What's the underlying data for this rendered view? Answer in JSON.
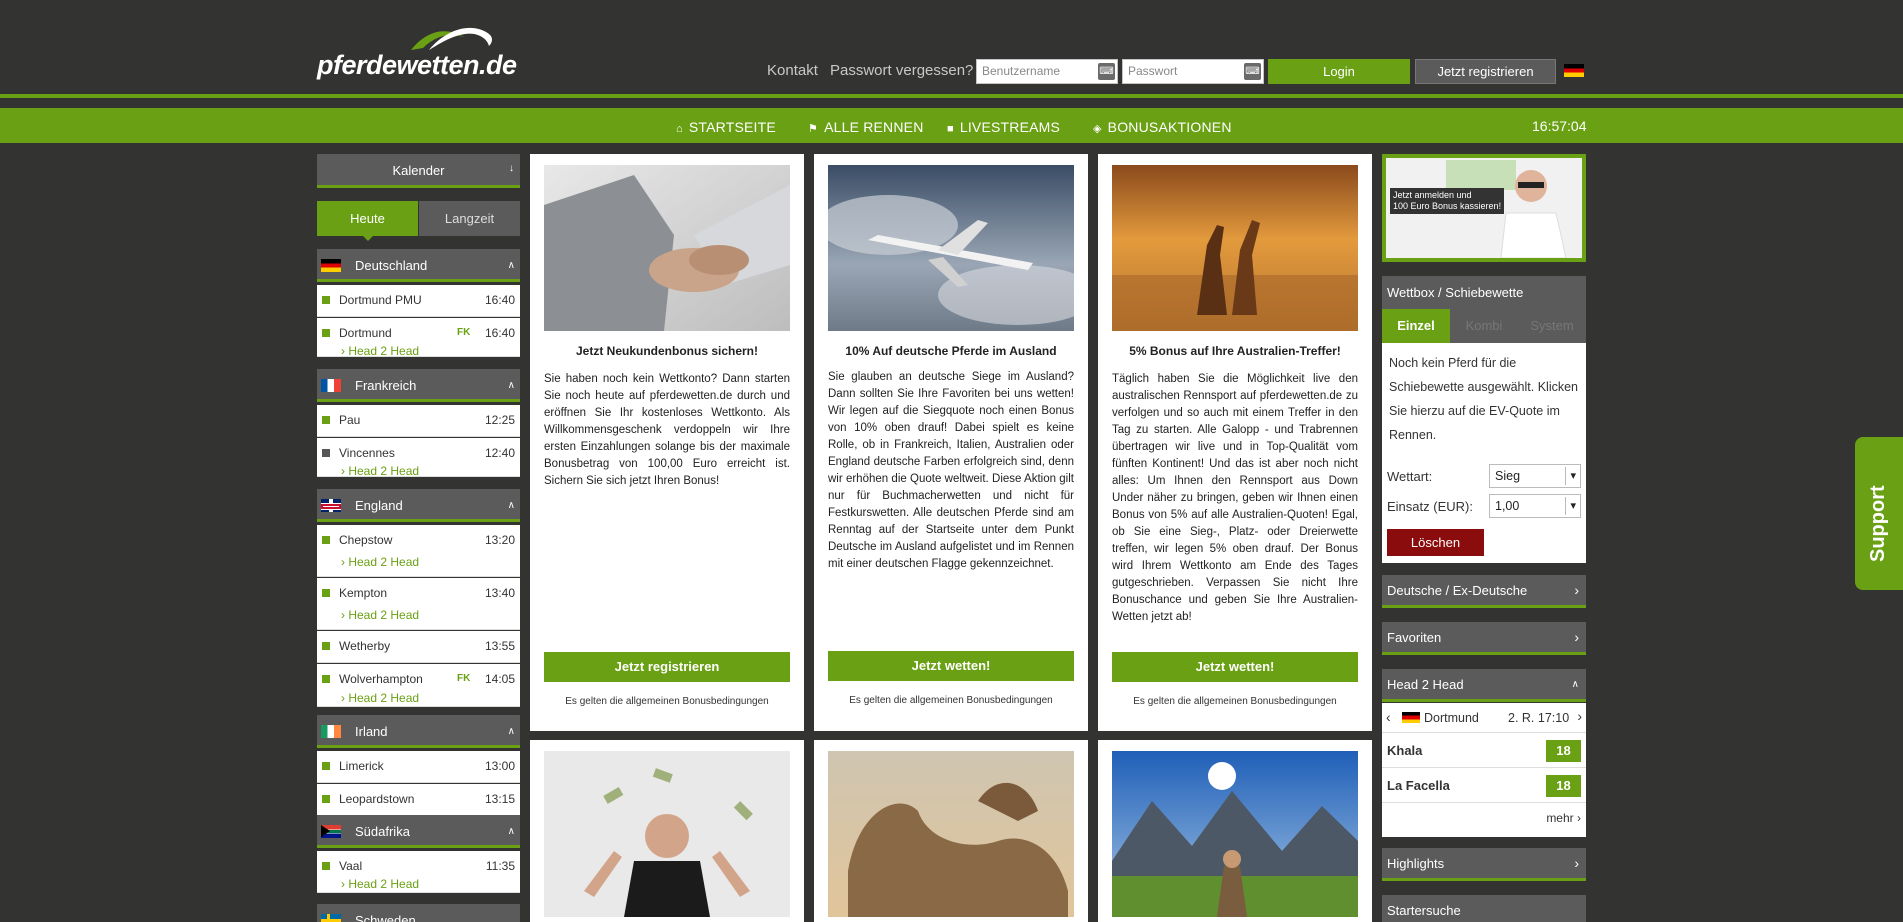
{
  "header": {
    "logo_text": "pferdewetten.de",
    "links": {
      "contact": "Kontakt",
      "forgot": "Passwort vergessen?"
    },
    "username_placeholder": "Benutzername",
    "password_placeholder": "Passwort",
    "login_label": "Login",
    "register_label": "Jetzt registrieren",
    "language_flag": "de-flag-icon"
  },
  "nav": {
    "items": [
      {
        "label": "STARTSEITE",
        "icon": "home-icon"
      },
      {
        "label": "ALLE RENNEN",
        "icon": "flag-icon"
      },
      {
        "label": "LIVESTREAMS",
        "icon": "video-icon"
      },
      {
        "label": "BONUSAKTIONEN",
        "icon": "tag-icon"
      }
    ],
    "clock": "16:57:04"
  },
  "sidebar": {
    "calendar_label": "Kalender",
    "tabs": [
      "Heute",
      "Langzeit"
    ],
    "h2h_label": "Head 2 Head",
    "fk": "FK",
    "countries": [
      {
        "name": "Deutschland",
        "races": [
          {
            "name": "Dortmund PMU",
            "time": "16:40"
          },
          {
            "name": "Dortmund",
            "time": "16:40",
            "fk": true,
            "h2h": true
          }
        ]
      },
      {
        "name": "Frankreich",
        "races": [
          {
            "name": "Pau",
            "time": "12:25"
          },
          {
            "name": "Vincennes",
            "time": "12:40",
            "h2h": true
          }
        ]
      },
      {
        "name": "England",
        "races": [
          {
            "name": "Chepstow",
            "time": "13:20",
            "h2h": true
          },
          {
            "name": "Kempton",
            "time": "13:40",
            "h2h": true
          },
          {
            "name": "Wetherby",
            "time": "13:55"
          },
          {
            "name": "Wolverhampton",
            "time": "14:05",
            "fk": true,
            "h2h": true
          }
        ]
      },
      {
        "name": "Irland",
        "races": [
          {
            "name": "Limerick",
            "time": "13:00"
          },
          {
            "name": "Leopardstown",
            "time": "13:15"
          }
        ]
      },
      {
        "name": "Südafrika",
        "races": [
          {
            "name": "Vaal",
            "time": "11:35",
            "h2h": true
          }
        ]
      },
      {
        "name": "Schweden",
        "races": []
      }
    ]
  },
  "cards": [
    {
      "title": "Jetzt Neukundenbonus sichern!",
      "text": "Sie haben noch kein Wettkonto? Dann starten Sie noch heute auf pferdewetten.de durch und eröffnen Sie Ihr kostenloses Wettkonto. Als Willkommensgeschenk verdoppeln wir Ihre ersten Einzahlungen solange bis der maximale Bonusbetrag von 100,00 Euro erreicht ist. Sichern Sie sich jetzt Ihren Bonus!",
      "button": "Jetzt registrieren",
      "terms": "Es gelten die allgemeinen Bonusbedingungen"
    },
    {
      "title": "10% Auf deutsche Pferde im Ausland",
      "text": "Sie glauben an deutsche Siege im Ausland? Dann sollten Sie Ihre Favoriten bei uns wetten! Wir legen auf die Siegquote noch einen Bonus von 10% oben drauf! Dabei spielt es keine Rolle, ob in Frankreich, Italien, Australien oder England deutsche Farben erfolgreich sind, denn wir erhöhen die Quote weltweit. Diese Aktion gilt nur für Buchmacherwetten und nicht für Festkurswetten. Alle deutschen Pferde sind am Renntag auf der Startseite unter dem Punkt Deutsche im Ausland aufgelistet und im Rennen mit einer deutschen Flagge gekennzeichnet.",
      "button": "Jetzt wetten!",
      "terms": "Es gelten die allgemeinen Bonusbedingungen"
    },
    {
      "title": "5% Bonus auf Ihre Australien-Treffer!",
      "text": "Täglich haben Sie die Möglichkeit live den australischen Rennsport auf pferdewetten.de zu verfolgen und so auch mit einem Treffer in den Tag zu starten. Alle Galopp - und Trabrennen übertragen wir live und in Top-Qualität vom fünften Kontinent! Und das ist aber noch nicht alles: Um Ihnen den Rennsport aus Down Under näher zu bringen, geben wir Ihnen einen Bonus von 5% auf alle Australien-Quoten! Egal, ob Sie eine Sieg-, Platz- oder Dreierwette treffen, wir legen 5% oben drauf. Der Bonus wird Ihrem Wettkonto am Ende des Tages gutgeschrieben. Verpassen Sie nicht Ihre Bonuschance und geben Sie Ihre Australien-Wetten jetzt ab!",
      "button": "Jetzt wetten!",
      "terms": "Es gelten die allgemeinen Bonusbedingungen"
    }
  ],
  "right": {
    "promo_text_1": "Jetzt anmelden und",
    "promo_text_2": "100 Euro Bonus kassieren!",
    "wettbox_title": "Wettbox / Schiebewette",
    "wettbox_tabs": [
      "Einzel",
      "Kombi",
      "System"
    ],
    "wettbox_msg": "Noch kein Pferd für die Schiebewette ausgewählt. Klicken Sie hierzu auf die EV-Quote im Rennen.",
    "wettart_label": "Wettart:",
    "wettart_value": "Sieg",
    "einsatz_label": "Einsatz (EUR):",
    "einsatz_value": "1,00",
    "delete_label": "Löschen",
    "bars": [
      "Deutsche / Ex-Deutsche",
      "Favoriten"
    ],
    "h2h": {
      "title": "Head 2 Head",
      "track": "Dortmund",
      "race": "2. R. 17:10",
      "horses": [
        {
          "name": "Khala",
          "value": "18"
        },
        {
          "name": "La Facella",
          "value": "18"
        }
      ],
      "more": "mehr"
    },
    "bottom_bars": [
      "Highlights",
      "Startersuche"
    ]
  },
  "support_label": "Support"
}
